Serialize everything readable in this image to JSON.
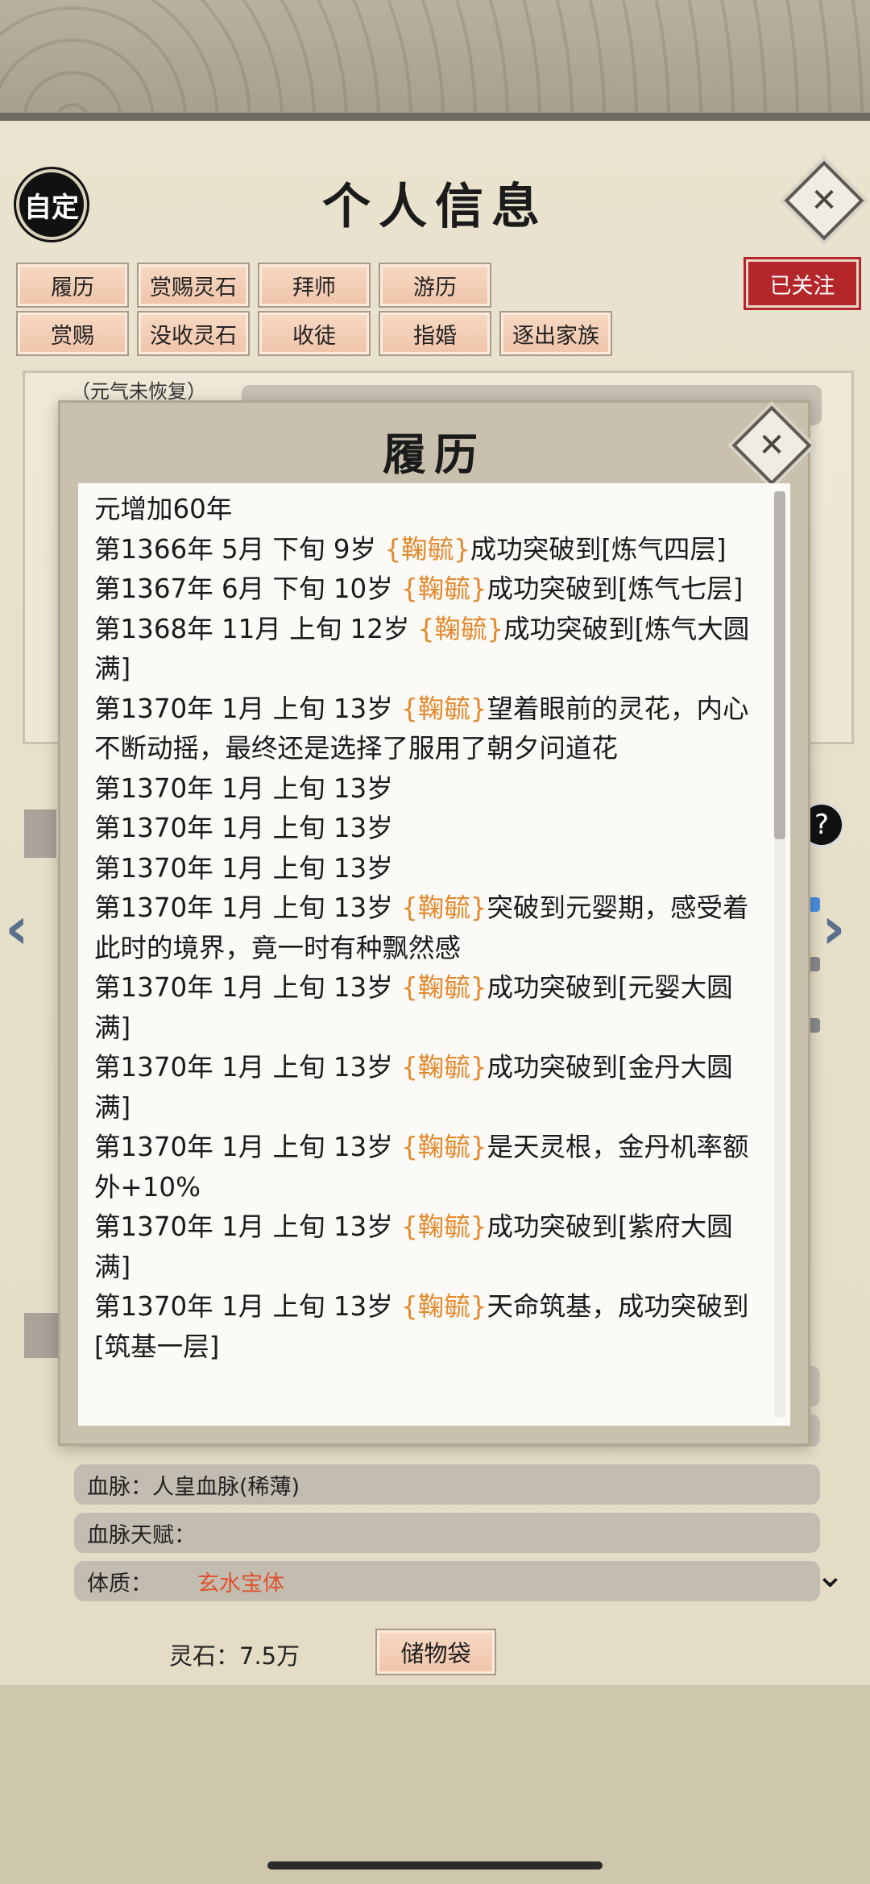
{
  "header": {
    "title": "个人信息",
    "custom_label": "自定",
    "follow_label": "已关注"
  },
  "actions_row1": [
    "履历",
    "赏赐灵石",
    "拜师",
    "游历"
  ],
  "actions_row2": [
    "赏赐",
    "没收灵石",
    "收徒",
    "指婚",
    "逐出家族"
  ],
  "background": {
    "status": "（元气未恢复）"
  },
  "modal": {
    "title": "履历",
    "entries": [
      {
        "text": "元增加60年"
      },
      {
        "pre": "第1366年 5月 下旬  9岁 ",
        "name": "{鞠毓}",
        "post": "成功突破到[炼气四层]"
      },
      {
        "pre": "第1367年 6月 下旬  10岁 ",
        "name": "{鞠毓}",
        "post": "成功突破到[炼气七层]"
      },
      {
        "pre": "第1368年 11月 上旬  12岁 ",
        "name": "{鞠毓}",
        "post": "成功突破到[炼气大圆满]"
      },
      {
        "pre": "第1370年 1月 上旬 13岁 ",
        "name": "{鞠毓}",
        "post": "望着眼前的灵花，内心不断动摇，最终还是选择了服用了朝夕问道花"
      },
      {
        "text": "第1370年 1月  上旬  13岁"
      },
      {
        "text": "第1370年 1月  上旬  13岁"
      },
      {
        "text": "第1370年 1月  上旬  13岁"
      },
      {
        "pre": "第1370年 1月 上旬 13岁 ",
        "name": "{鞠毓}",
        "post": "突破到元婴期，感受着此时的境界，竟一时有种飘然感"
      },
      {
        "pre": "第1370年 1月  上旬  13岁  ",
        "name": "{鞠毓}",
        "post": "成功突破到[元婴大圆满]"
      },
      {
        "pre": "第1370年 1月  上旬  13岁  ",
        "name": "{鞠毓}",
        "post": "成功突破到[金丹大圆满]"
      },
      {
        "pre": "第1370年 1月  上旬  13岁  ",
        "name": "{鞠毓}",
        "post": "是天灵根，金丹机率额外+10%"
      },
      {
        "pre": "第1370年 1月  上旬  13岁  ",
        "name": "{鞠毓}",
        "post": "成功突破到[紫府大圆满]"
      },
      {
        "pre": "第1370年 1月 上旬 13岁 ",
        "name": "{鞠毓}",
        "post": "天命筑基，成功突破到[筑基一层]"
      }
    ]
  },
  "info": {
    "bloodline": "血脉：人皇血脉(稀薄)",
    "bloodline_talent": "血脉天赋：",
    "physique_label": "体质：",
    "physique_value": "玄水宝体"
  },
  "footer": {
    "stones": "灵石：7.5万",
    "bag_label": "储物袋"
  },
  "colors": {
    "name_highlight": "#e38a2f",
    "follow_red": "#b5262a",
    "physique_red": "#e0522b"
  }
}
